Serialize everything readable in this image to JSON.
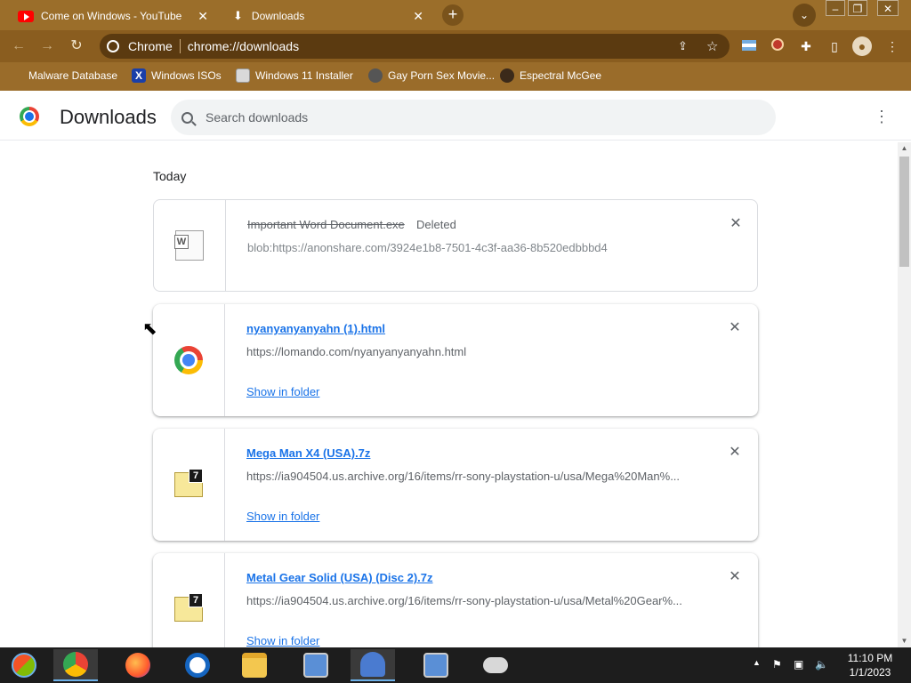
{
  "tabs": [
    {
      "title": "Come on Windows - YouTube",
      "icon": "youtube-icon",
      "color": "#ff0000"
    },
    {
      "title": "Downloads",
      "icon": "download-icon"
    }
  ],
  "toolbar": {
    "site_chip": "Chrome",
    "url": "chrome://downloads"
  },
  "bookmarks": [
    {
      "label": "Malware Database",
      "icon": "folder-icon"
    },
    {
      "label": "Windows ISOs",
      "icon": "x-logo-icon",
      "color": "#1a3fa8"
    },
    {
      "label": "Windows 11 Installer",
      "icon": "image-icon"
    },
    {
      "label": "Gay Porn Sex Movie...",
      "icon": "film-icon"
    },
    {
      "label": "Espectral McGee",
      "icon": "avatar-icon"
    }
  ],
  "page": {
    "title": "Downloads",
    "search_placeholder": "Search downloads",
    "section_label": "Today"
  },
  "downloads": [
    {
      "filename": "Important Word Document.exe",
      "status": "Deleted",
      "url": "blob:https://anonshare.com/3924e1b8-7501-4c3f-aa36-8b520edbbbd4",
      "icon": "word-document-icon",
      "deleted": true
    },
    {
      "filename": "nyanyanyanyahn (1).html",
      "url": "https://lomando.com/nyanyanyanyahn.html",
      "action": "Show in folder",
      "icon": "chrome-file-icon"
    },
    {
      "filename": "Mega Man X4 (USA).7z",
      "url": "https://ia904504.us.archive.org/16/items/rr-sony-playstation-u/usa/Mega%20Man%...",
      "action": "Show in folder",
      "icon": "7z-archive-icon"
    },
    {
      "filename": "Metal Gear Solid (USA) (Disc 2).7z",
      "url": "https://ia904504.us.archive.org/16/items/rr-sony-playstation-u/usa/Metal%20Gear%...",
      "action": "Show in folder",
      "icon": "7z-archive-icon"
    }
  ],
  "taskbar": {
    "time": "11:10 PM",
    "date": "1/1/2023",
    "apps": [
      "start-button-icon",
      "chrome-icon",
      "firefox-icon",
      "opera-icon",
      "file-explorer-icon",
      "network-computer-icon",
      "users-icon",
      "network-computer-icon",
      "gamepad-icon"
    ]
  }
}
